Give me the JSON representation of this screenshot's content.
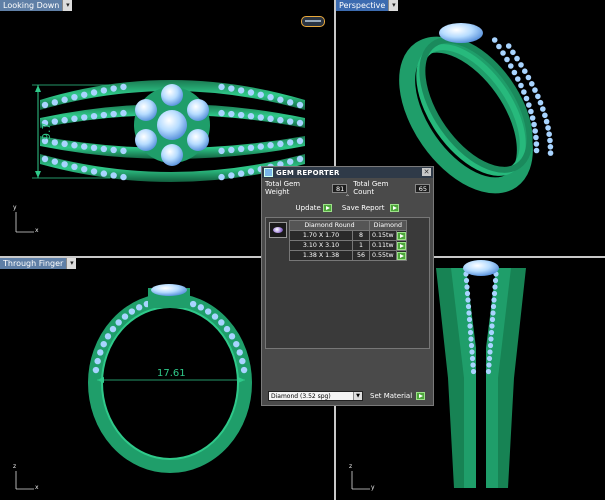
{
  "viewports": {
    "top_left": {
      "label": "Looking Down",
      "dimension": "9.7",
      "axis_y": "y",
      "axis_x": "x"
    },
    "top_right": {
      "label": "Perspective"
    },
    "bottom_left": {
      "label": "Through Finger",
      "dimension": "17.61",
      "axis_z": "z",
      "axis_x": "x"
    },
    "bottom_right": {
      "axis_z": "z",
      "axis_y": "y"
    }
  },
  "gem_reporter": {
    "title": "GEM REPORTER",
    "total_gem_weight_label": "Total Gem Weight",
    "total_gem_weight": "81",
    "total_gem_count_label": "Total Gem Count",
    "total_gem_count": "65",
    "update_label": "Update",
    "save_report_label": "Save Report",
    "table": {
      "headers": [
        "Diamond Round",
        "",
        "Diamond"
      ],
      "rows": [
        {
          "size": "1.70 X 1.70",
          "count": "8",
          "weight": "0.15tw"
        },
        {
          "size": "3.10 X 3.10",
          "count": "1",
          "weight": "0.11tw"
        },
        {
          "size": "1.38 X 1.38",
          "count": "56",
          "weight": "0.55tw"
        }
      ]
    },
    "material_select": "Diamond   (3.52 spg)",
    "set_material_label": "Set Material"
  },
  "colors": {
    "ring_green": "#1f9e6a",
    "gem_blue": "#9fd0ff",
    "panel_bg": "#4a4a4a"
  }
}
